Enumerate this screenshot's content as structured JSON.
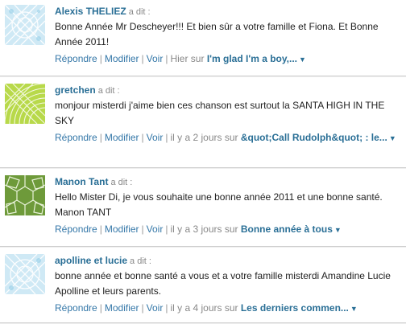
{
  "comments": [
    {
      "author": "Alexis THELIEZ",
      "said": "a dit :",
      "body": "Bonne Année Mr Descheyer!!! Et bien sûr a votre famille et Fiona. Et Bonne Année 2011!",
      "reply": "Répondre",
      "edit": "Modifier",
      "view": "Voir",
      "when": "Hier sur",
      "post_title": "I'm glad I'm a boy,...",
      "avatar_icon": "lace-pattern-avatar-icon",
      "avatar_color": "#8ccbe6"
    },
    {
      "author": "gretchen",
      "said": "a dit :",
      "body": "monjour misterdi j'aime bien ces chanson est surtout la SANTA HIGH IN THE SKY",
      "reply": "Répondre",
      "edit": "Modifier",
      "view": "Voir",
      "when": "il y a 2 jours sur",
      "post_title": "&quot;Call Rudolph&quot; : le...",
      "avatar_icon": "lime-arcs-avatar-icon",
      "avatar_color": "#b8d94a"
    },
    {
      "author": "Manon Tant",
      "said": "a dit :",
      "body": "Hello Mister Di, je vous souhaite une bonne année 2011 et une bonne santé. Manon TANT",
      "reply": "Répondre",
      "edit": "Modifier",
      "view": "Voir",
      "when": "il y a 3 jours sur",
      "post_title": "Bonne année à tous",
      "avatar_icon": "green-geodesic-avatar-icon",
      "avatar_color": "#6e9a3a"
    },
    {
      "author": "apolline et lucie",
      "said": "a dit :",
      "body": "bonne année et bonne santé a vous et a votre famille misterdi Amandine Lucie Apolline et leurs parents.",
      "reply": "Répondre",
      "edit": "Modifier",
      "view": "Voir",
      "when": "il y a 4 jours sur",
      "post_title": "Les derniers commen...",
      "avatar_icon": "blue-lace-avatar-icon",
      "avatar_color": "#8ccbe6"
    }
  ],
  "caret_icon": "caret-down-icon"
}
